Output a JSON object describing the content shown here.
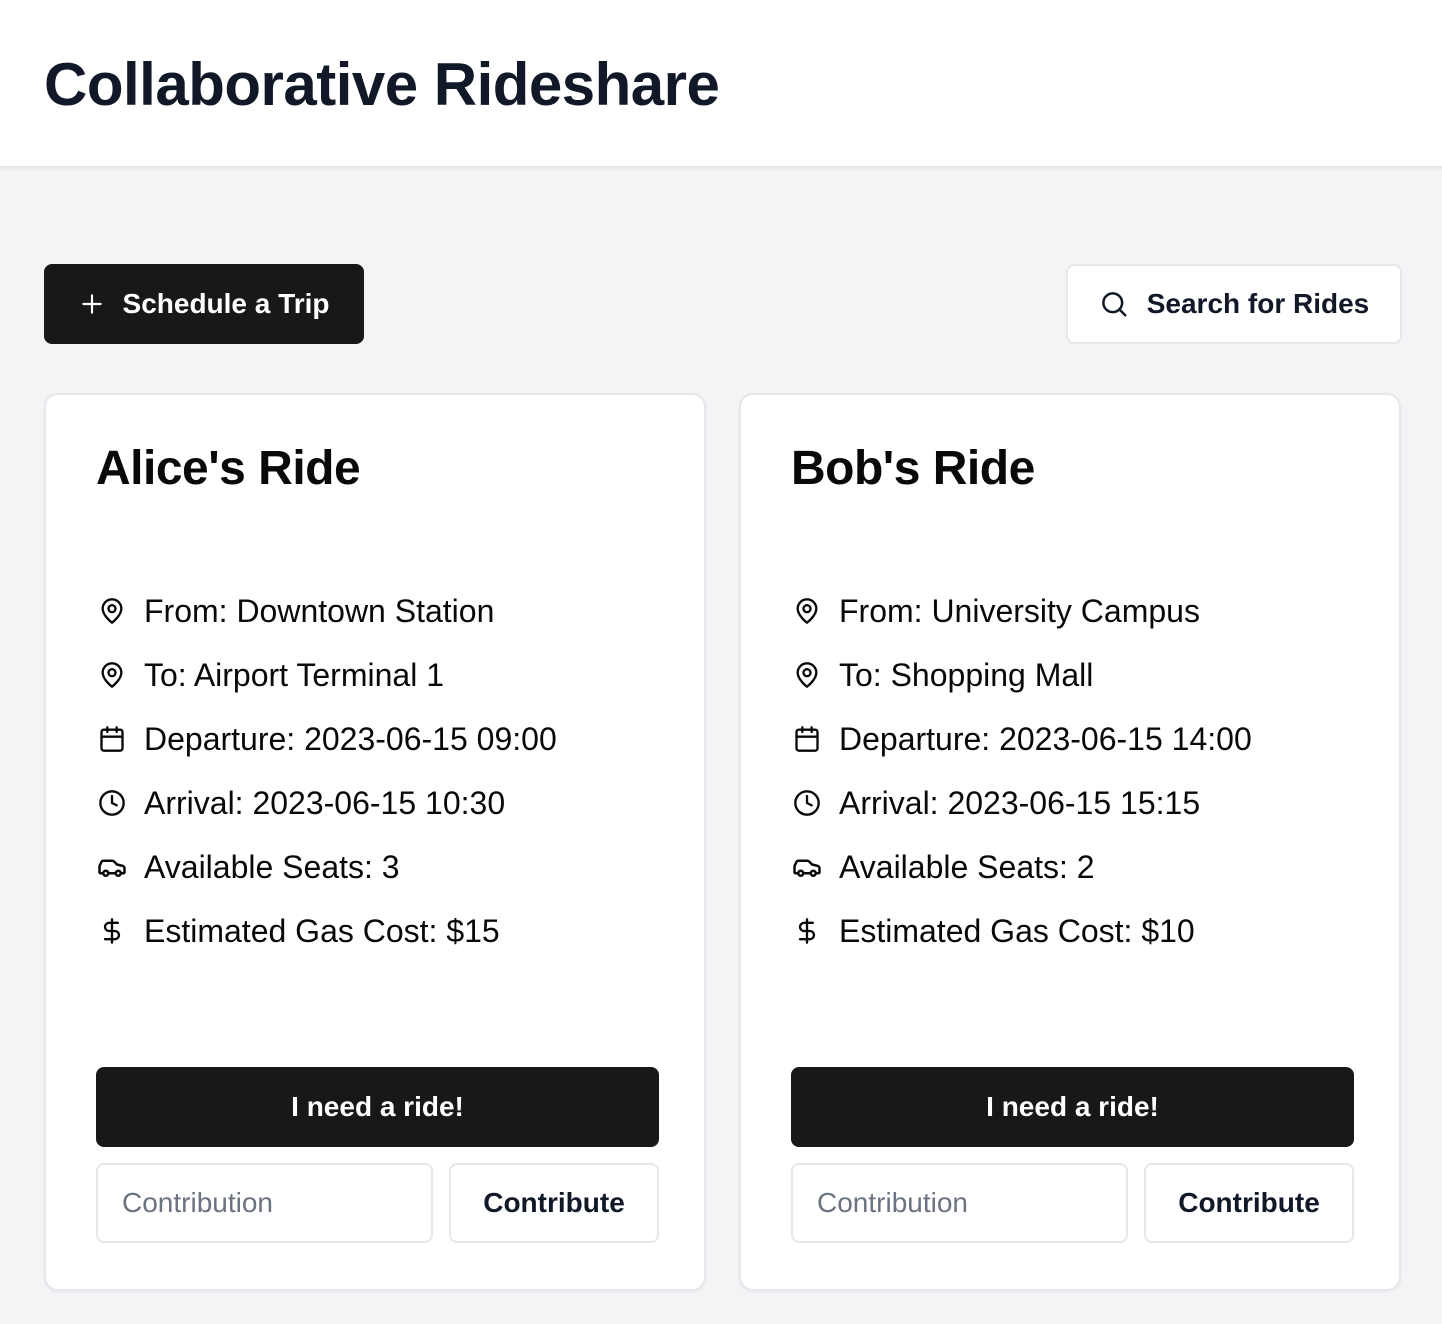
{
  "app": {
    "title": "Collaborative Rideshare"
  },
  "actions": {
    "schedule_label": "Schedule a Trip",
    "search_label": "Search for Rides"
  },
  "rides": [
    {
      "title": "Alice's Ride",
      "from": "From: Downtown Station",
      "to": "To: Airport Terminal 1",
      "departure": "Departure: 2023-06-15 09:00",
      "arrival": "Arrival: 2023-06-15 10:30",
      "seats": "Available Seats: 3",
      "gas": "Estimated Gas Cost: $15",
      "ride_button": "I need a ride!",
      "contribution_placeholder": "Contribution",
      "contribute_button": "Contribute"
    },
    {
      "title": "Bob's Ride",
      "from": "From: University Campus",
      "to": "To: Shopping Mall",
      "departure": "Departure: 2023-06-15 14:00",
      "arrival": "Arrival: 2023-06-15 15:15",
      "seats": "Available Seats: 2",
      "gas": "Estimated Gas Cost: $10",
      "ride_button": "I need a ride!",
      "contribution_placeholder": "Contribution",
      "contribute_button": "Contribute"
    }
  ],
  "icons": {
    "schedule": "plus-icon",
    "search": "search-icon",
    "from": "map-pin-icon",
    "to": "map-pin-icon",
    "departure": "calendar-icon",
    "arrival": "clock-icon",
    "seats": "car-icon",
    "gas": "dollar-icon"
  },
  "colors": {
    "primary": "#18181b",
    "background": "#f3f4f6",
    "card": "#ffffff",
    "border": "#e5e7eb",
    "placeholder": "#6b7280"
  }
}
